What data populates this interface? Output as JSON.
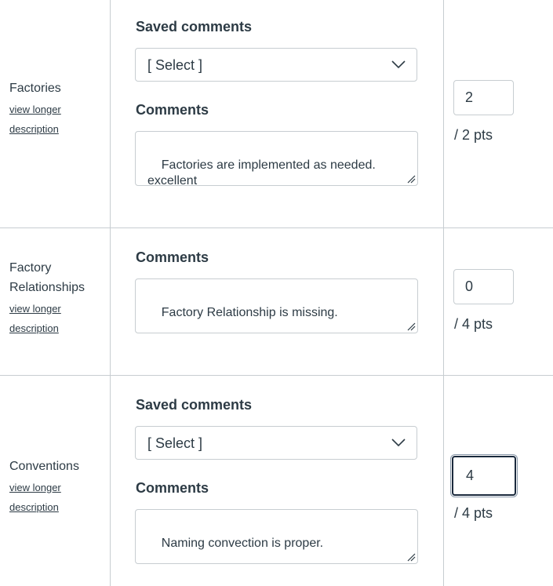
{
  "criteria": [
    {
      "title": "Factories",
      "link_line1": "view longer",
      "link_line2": "description",
      "saved_comments_label": "Saved comments",
      "select_value": "[ Select ]",
      "comments_label": "Comments",
      "comment": "Factories are implemented as needed.\nexcellent",
      "points": "2",
      "max_points": "/ 2 pts"
    },
    {
      "title_line1": "Factory",
      "title_line2": "Relationships",
      "link_line1": "view longer",
      "link_line2": "description",
      "comments_label": "Comments",
      "comment": "Factory Relationship is missing.",
      "points": "0",
      "max_points": "/ 4 pts"
    },
    {
      "title": "Conventions",
      "link_line1": "view longer",
      "link_line2": "description",
      "saved_comments_label": "Saved comments",
      "select_value": "[ Select ]",
      "comments_label": "Comments",
      "comment": "Naming convection is proper.",
      "points": "4",
      "max_points": "/ 4 pts"
    }
  ],
  "icons": {
    "dropdown": "chevron-down-icon",
    "resize": "resize-handle-icon"
  },
  "colors": {
    "text": "#2d3b45",
    "border": "#c7cdd1",
    "focus": "#1b2a3d"
  }
}
